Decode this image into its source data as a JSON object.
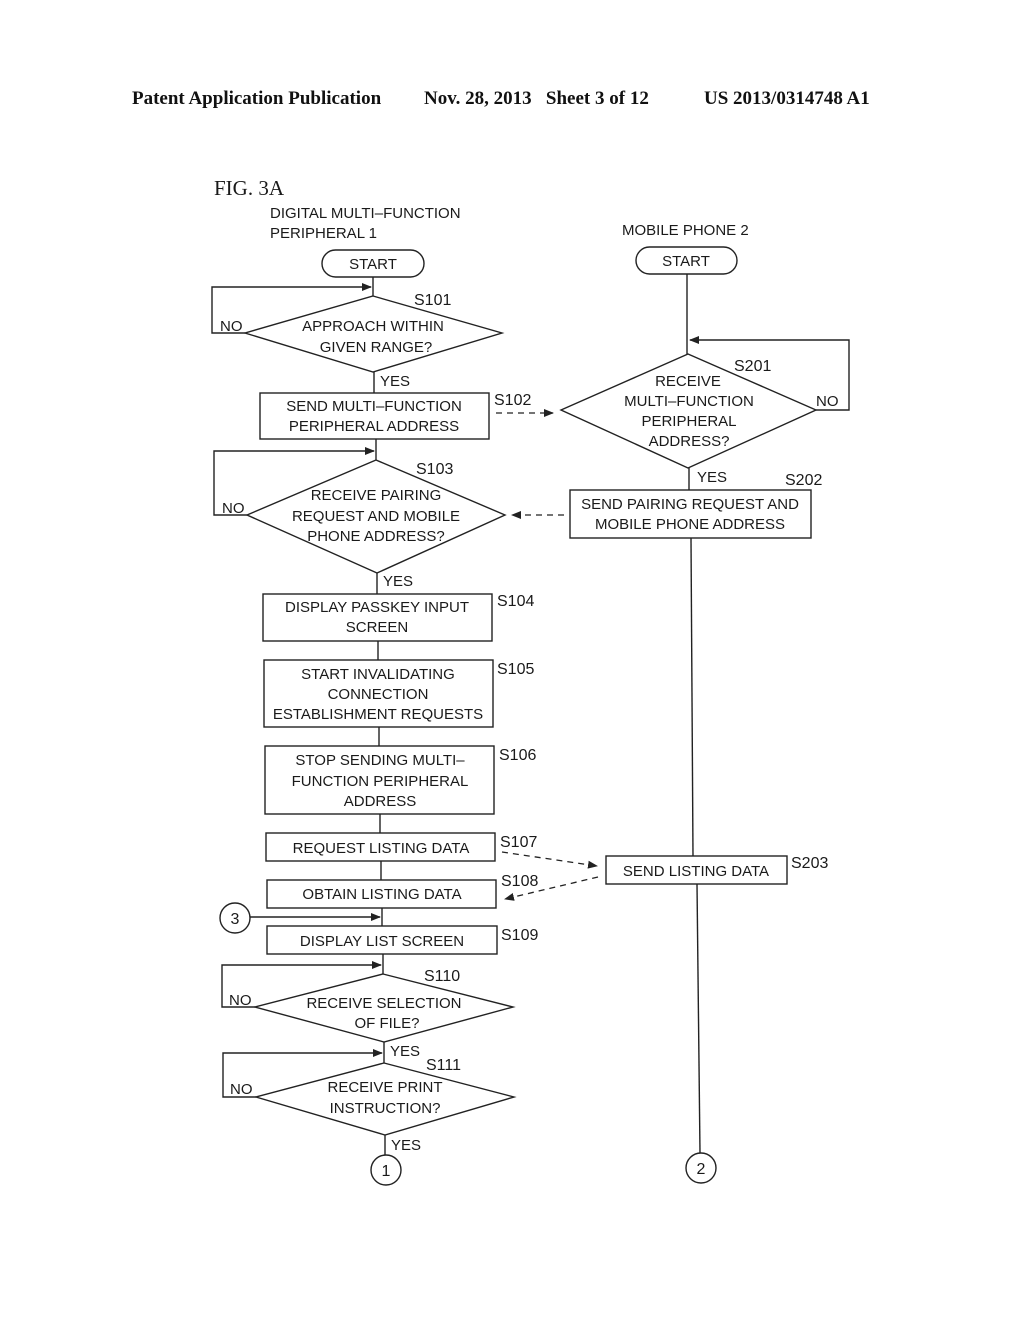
{
  "header": {
    "publication": "Patent Application Publication",
    "date_sheet": "Nov. 28, 2013   Sheet 3 of 12",
    "patent_number": "US 2013/0314748 A1"
  },
  "figure": {
    "label": "FIG. 3A",
    "lane_left_title": [
      "DIGITAL MULTI–FUNCTION",
      "PERIPHERAL 1"
    ],
    "lane_right_title": "MOBILE PHONE 2",
    "start_label": "START",
    "yes": "YES",
    "no": "NO"
  },
  "steps": {
    "S101": {
      "id": "S101",
      "type": "decision",
      "lines": [
        "APPROACH WITHIN",
        "GIVEN RANGE?"
      ]
    },
    "S102": {
      "id": "S102",
      "type": "process",
      "lines": [
        "SEND MULTI–FUNCTION",
        "PERIPHERAL ADDRESS"
      ]
    },
    "S103": {
      "id": "S103",
      "type": "decision",
      "lines": [
        "RECEIVE PAIRING",
        "REQUEST AND MOBILE",
        "PHONE ADDRESS?"
      ]
    },
    "S104": {
      "id": "S104",
      "type": "process",
      "lines": [
        "DISPLAY PASSKEY INPUT",
        "SCREEN"
      ]
    },
    "S105": {
      "id": "S105",
      "type": "process",
      "lines": [
        "START INVALIDATING",
        "CONNECTION",
        "ESTABLISHMENT REQUESTS"
      ]
    },
    "S106": {
      "id": "S106",
      "type": "process",
      "lines": [
        "STOP SENDING MULTI–",
        "FUNCTION PERIPHERAL",
        "ADDRESS"
      ]
    },
    "S107": {
      "id": "S107",
      "type": "process",
      "lines": [
        "REQUEST LISTING DATA"
      ]
    },
    "S108": {
      "id": "S108",
      "type": "process",
      "lines": [
        "OBTAIN LISTING DATA"
      ]
    },
    "S109": {
      "id": "S109",
      "type": "process",
      "lines": [
        "DISPLAY LIST SCREEN"
      ]
    },
    "S110": {
      "id": "S110",
      "type": "decision",
      "lines": [
        "RECEIVE SELECTION",
        "OF FILE?"
      ]
    },
    "S111": {
      "id": "S111",
      "type": "decision",
      "lines": [
        "RECEIVE PRINT",
        "INSTRUCTION?"
      ]
    },
    "S201": {
      "id": "S201",
      "type": "decision",
      "lines": [
        "RECEIVE",
        "MULTI–FUNCTION",
        "PERIPHERAL",
        "ADDRESS?"
      ]
    },
    "S202": {
      "id": "S202",
      "type": "process",
      "lines": [
        "SEND PAIRING REQUEST AND",
        "MOBILE PHONE ADDRESS"
      ]
    },
    "S203": {
      "id": "S203",
      "type": "process",
      "lines": [
        "SEND LISTING DATA"
      ]
    }
  },
  "connectors": {
    "c1": "1",
    "c2": "2",
    "c3": "3"
  },
  "messages": [
    {
      "from": "S102",
      "to": "S201",
      "style": "dashed"
    },
    {
      "from": "S202",
      "to": "S103",
      "style": "dashed"
    },
    {
      "from": "S107",
      "to": "S203",
      "style": "dashed"
    },
    {
      "from": "S203",
      "to": "S108",
      "style": "dashed"
    }
  ]
}
